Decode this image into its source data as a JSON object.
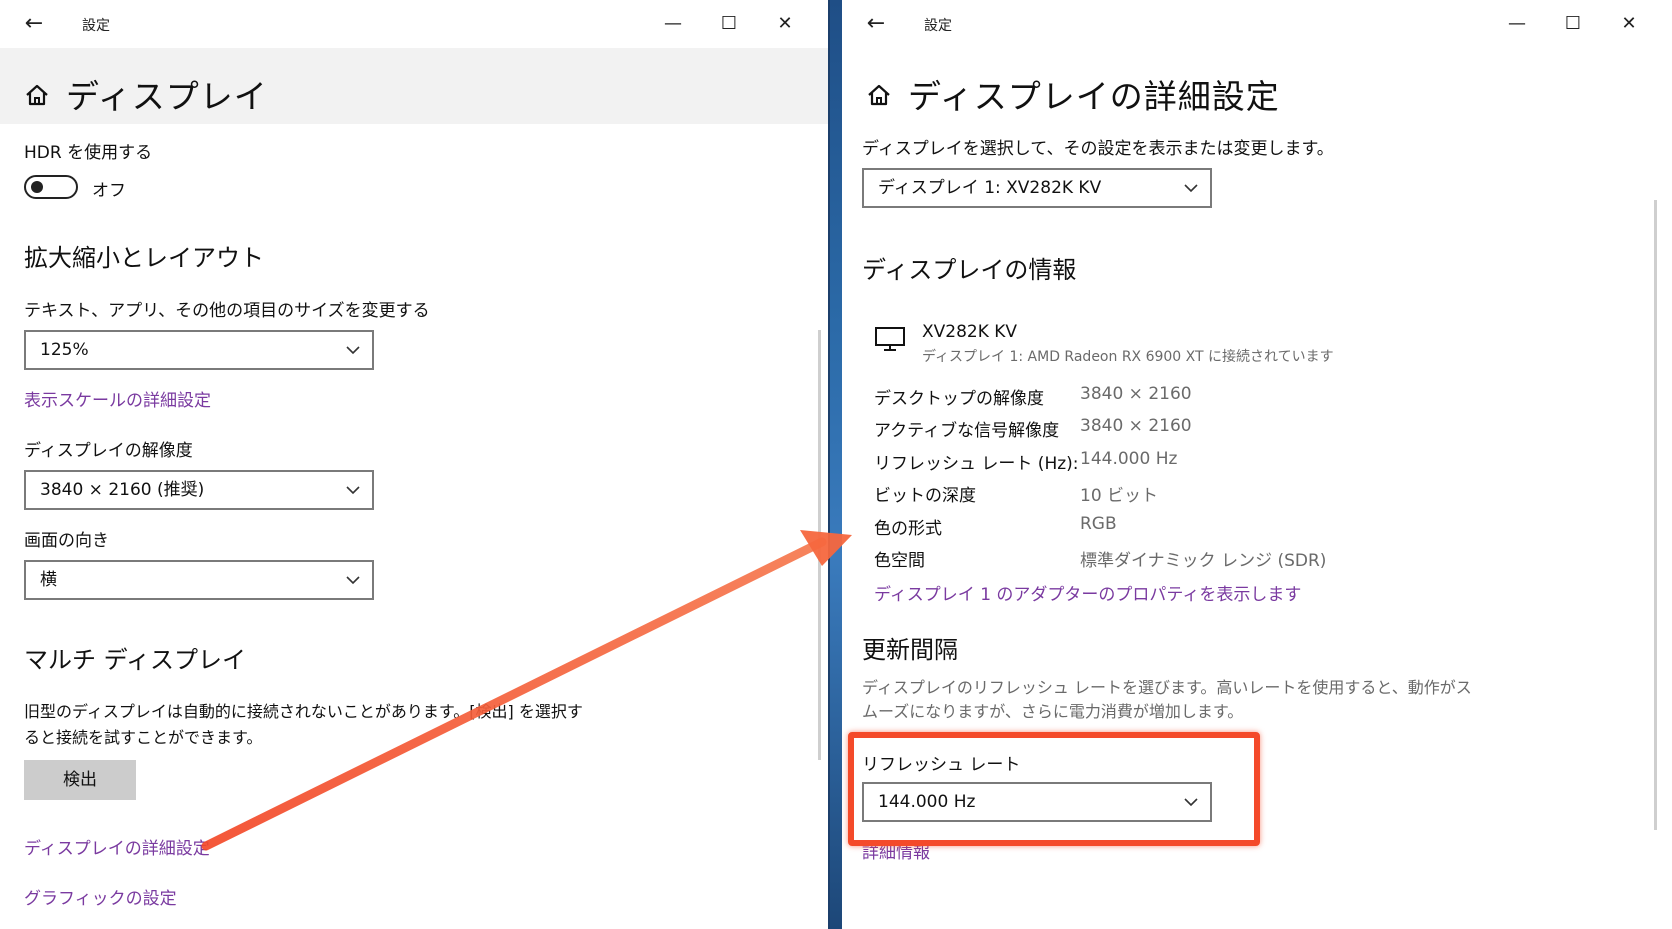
{
  "left": {
    "window_title": "設定",
    "page_title": "ディスプレイ",
    "hdr_label": "HDR を使用する",
    "hdr_state": "オフ",
    "scale_section": "拡大縮小とレイアウト",
    "scale_label": "テキスト、アプリ、その他の項目のサイズを変更する",
    "scale_value": "125%",
    "scale_advanced_link": "表示スケールの詳細設定",
    "resolution_label": "ディスプレイの解像度",
    "resolution_value": "3840 × 2160 (推奨)",
    "orientation_label": "画面の向き",
    "orientation_value": "横",
    "multi_section": "マルチ ディスプレイ",
    "multi_desc_1": "旧型のディスプレイは自動的に接続されないことがあります。[検出] を選択す",
    "multi_desc_2": "ると接続を試すことができます。",
    "detect_button": "検出",
    "advanced_display_link": "ディスプレイの詳細設定",
    "graphics_link": "グラフィックの設定"
  },
  "right": {
    "window_title": "設定",
    "page_title": "ディスプレイの詳細設定",
    "select_prompt": "ディスプレイを選択して、その設定を表示または変更します。",
    "display_select": "ディスプレイ 1: XV282K KV",
    "info_section": "ディスプレイの情報",
    "monitor_name": "XV282K KV",
    "monitor_sub": "ディスプレイ 1: AMD Radeon RX 6900 XT に接続されています",
    "info_rows": [
      {
        "label": "デスクトップの解像度",
        "value": "3840 × 2160"
      },
      {
        "label": "アクティブな信号解像度",
        "value": "3840 × 2160"
      },
      {
        "label": "リフレッシュ レート (Hz):",
        "value": "144.000 Hz"
      },
      {
        "label": "ビットの深度",
        "value": "10 ビット"
      },
      {
        "label": "色の形式",
        "value": "RGB"
      },
      {
        "label": "色空間",
        "value": "標準ダイナミック レンジ (SDR)"
      }
    ],
    "adapter_link": "ディスプレイ 1 のアダプターのプロパティを表示します",
    "refresh_section": "更新間隔",
    "refresh_desc_1": "ディスプレイのリフレッシュ レートを選びます。高いレートを使用すると、動作がス",
    "refresh_desc_2": "ムーズになりますが、さらに電力消費が増加します。",
    "refresh_label": "リフレッシュ レート",
    "refresh_value": "144.000 Hz",
    "details_link": "詳細情報"
  },
  "colors": {
    "link": "#7a3aa0",
    "annotation": "#f44a2a"
  },
  "icons": [
    "back-arrow-icon",
    "minimize-icon",
    "maximize-icon",
    "close-icon",
    "home-icon",
    "chevron-down-icon",
    "monitor-icon"
  ]
}
